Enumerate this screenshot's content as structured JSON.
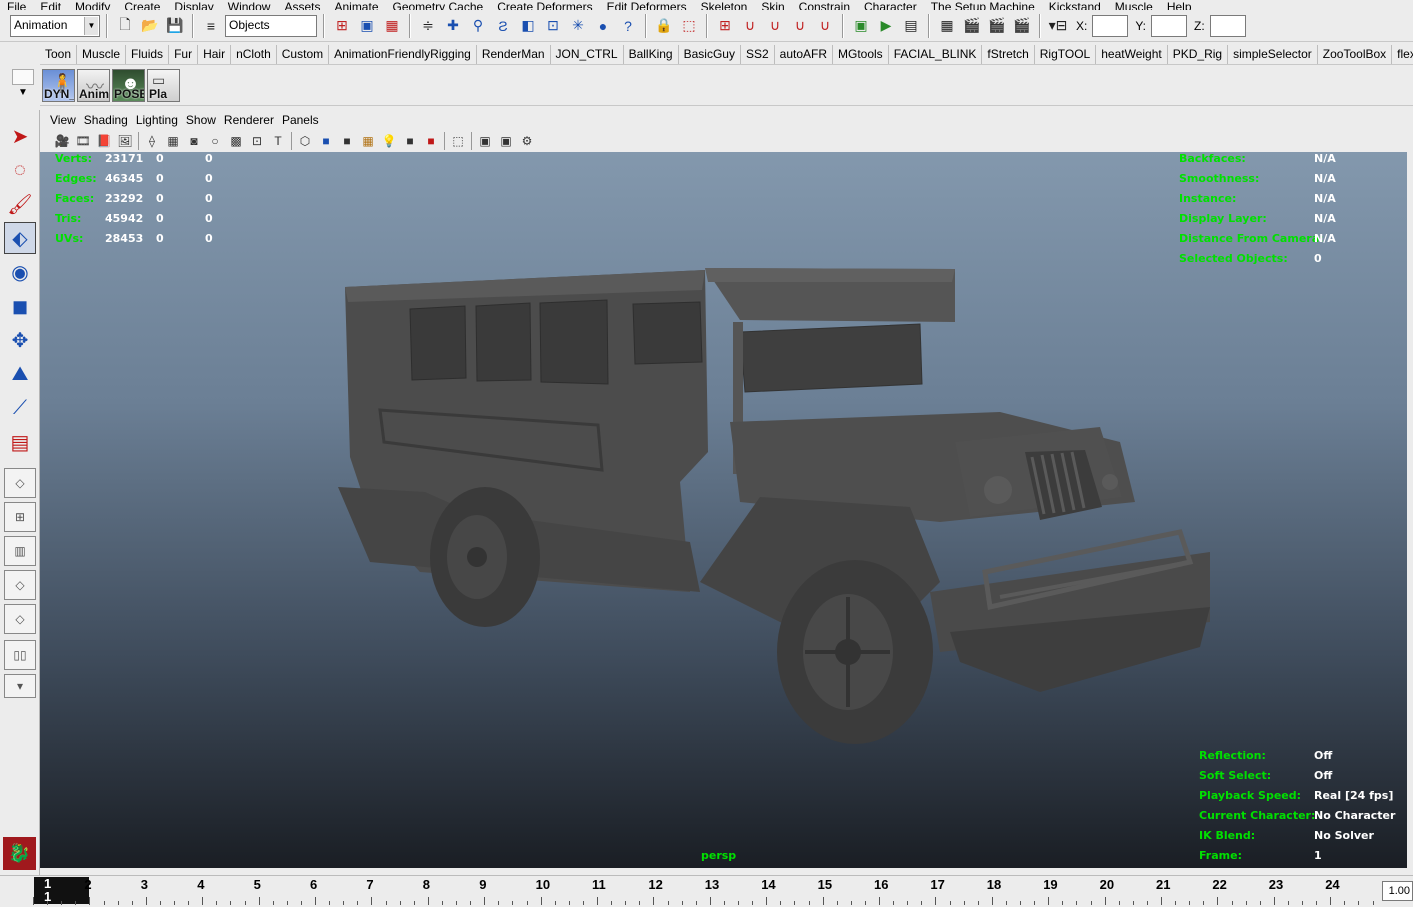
{
  "menubar": [
    "File",
    "Edit",
    "Modify",
    "Create",
    "Display",
    "Window",
    "Assets",
    "Animate",
    "Geometry Cache",
    "Create Deformers",
    "Edit Deformers",
    "Skeleton",
    "Skin",
    "Constrain",
    "Character",
    "The Setup Machine",
    "Kickstand",
    "Muscle",
    "Help"
  ],
  "statusline": {
    "mode": "Animation",
    "objects_field": "Objects",
    "x_label": "X:",
    "y_label": "Y:",
    "z_label": "Z:"
  },
  "shelf_tabs": [
    "Toon",
    "Muscle",
    "Fluids",
    "Fur",
    "Hair",
    "nCloth",
    "Custom",
    "AnimationFriendlyRigging",
    "RenderMan",
    "JON_CTRL",
    "BallKing",
    "BasicGuy",
    "SS2",
    "autoAFR",
    "MGtools",
    "FACIAL_BLINK",
    "fStretch",
    "RigTOOL",
    "heatWeight",
    "PKD_Rig",
    "simpleSelector",
    "ZooToolBox",
    "flexiblePivotSystem"
  ],
  "shelf_buttons": [
    "DYN_",
    "Anim",
    "POSE",
    "Pla"
  ],
  "panel_menu": [
    "View",
    "Shading",
    "Lighting",
    "Show",
    "Renderer",
    "Panels"
  ],
  "hud_left": [
    {
      "label": "Verts:",
      "v1": "23171",
      "v2": "0",
      "v3": "0"
    },
    {
      "label": "Edges:",
      "v1": "46345",
      "v2": "0",
      "v3": "0"
    },
    {
      "label": "Faces:",
      "v1": "23292",
      "v2": "0",
      "v3": "0"
    },
    {
      "label": "Tris:",
      "v1": "45942",
      "v2": "0",
      "v3": "0"
    },
    {
      "label": "UVs:",
      "v1": "28453",
      "v2": "0",
      "v3": "0"
    }
  ],
  "hud_right": [
    {
      "label": "Backfaces:",
      "value": "N/A"
    },
    {
      "label": "Smoothness:",
      "value": "N/A"
    },
    {
      "label": "Instance:",
      "value": "N/A"
    },
    {
      "label": "Display Layer:",
      "value": "N/A"
    },
    {
      "label": "Distance From Camera:",
      "value": "N/A"
    },
    {
      "label": "Selected Objects:",
      "value": "0"
    }
  ],
  "hud_bottom": [
    {
      "label": "Reflection:",
      "value": "Off"
    },
    {
      "label": "Soft Select:",
      "value": "Off"
    },
    {
      "label": "Playback Speed:",
      "value": "Real [24 fps]"
    },
    {
      "label": "Current Character:",
      "value": "No Character"
    },
    {
      "label": "IK Blend:",
      "value": "No Solver"
    },
    {
      "label": "Frame:",
      "value": "1"
    }
  ],
  "camera_label": "persp",
  "timeslider": {
    "current": "1",
    "current_sub": "1",
    "numbers": [
      "2",
      "3",
      "4",
      "5",
      "6",
      "7",
      "8",
      "9",
      "10",
      "11",
      "12",
      "13",
      "14",
      "15",
      "16",
      "17",
      "18",
      "19",
      "20",
      "21",
      "22",
      "23",
      "24"
    ],
    "playback_end": "1.00"
  },
  "colors": {
    "hud_label": "#00e000",
    "hud_value": "#ffffff",
    "model": "#4a4a4a"
  }
}
